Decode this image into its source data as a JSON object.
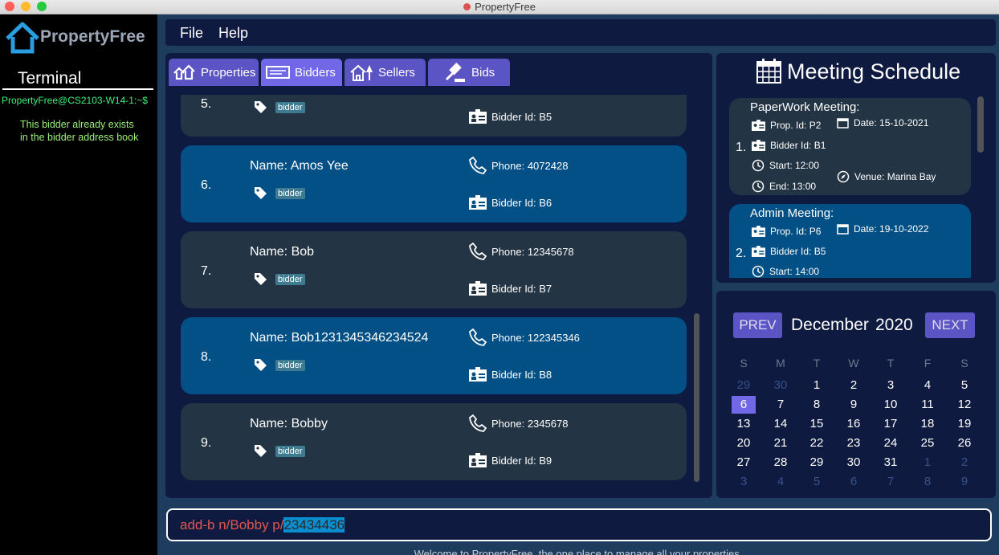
{
  "window": {
    "title": "PropertyFree"
  },
  "app": {
    "logo": "PropertyFree"
  },
  "terminal": {
    "label": "Terminal",
    "prompt": "PropertyFree@CS2103-W14-1:~$",
    "message": "This bidder already exists in the bidder address book"
  },
  "menu": [
    "File",
    "Help"
  ],
  "tabs": [
    {
      "label": "Properties",
      "icon": "houses-icon"
    },
    {
      "label": "Bidders",
      "icon": "id-card-icon"
    },
    {
      "label": "Sellers",
      "icon": "house-tree-icon"
    },
    {
      "label": "Bids",
      "icon": "gavel-icon"
    }
  ],
  "bidders": [
    {
      "index": "5.",
      "name": "",
      "tag": "bidder",
      "phone": "",
      "bidder_id": "Bidder Id: B5"
    },
    {
      "index": "6.",
      "name": "Name: Amos Yee",
      "tag": "bidder",
      "phone": "Phone: 4072428",
      "bidder_id": "Bidder Id: B6"
    },
    {
      "index": "7.",
      "name": "Name: Bob",
      "tag": "bidder",
      "phone": "Phone: 12345678",
      "bidder_id": "Bidder Id: B7"
    },
    {
      "index": "8.",
      "name": "Name: Bob1231345346234524",
      "tag": "bidder",
      "phone": "Phone: 122345346",
      "bidder_id": "Bidder Id: B8"
    },
    {
      "index": "9.",
      "name": "Name: Bobby",
      "tag": "bidder",
      "phone": "Phone: 2345678",
      "bidder_id": "Bidder Id: B9"
    }
  ],
  "schedule": {
    "title": "Meeting Schedule",
    "meetings": [
      {
        "index": "1.",
        "title": "PaperWork Meeting:",
        "prop_id": "Prop. Id: P2",
        "date": "Date: 15-10-2021",
        "bidder_id": "Bidder Id: B1",
        "start": "Start: 12:00",
        "end": "End: 13:00",
        "venue": "Venue: Marina Bay"
      },
      {
        "index": "2.",
        "title": "Admin Meeting:",
        "prop_id": "Prop. Id: P6",
        "date": "Date: 19-10-2022",
        "bidder_id": "Bidder Id: B5",
        "start": "Start: 14:00",
        "end": "",
        "venue": ""
      }
    ]
  },
  "calendar": {
    "prev": "PREV",
    "next": "NEXT",
    "month": "December",
    "year": "2020",
    "weekdays": [
      "S",
      "M",
      "T",
      "W",
      "T",
      "F",
      "S"
    ],
    "days": [
      "29",
      "30",
      "1",
      "2",
      "3",
      "4",
      "5",
      "6",
      "7",
      "8",
      "9",
      "10",
      "11",
      "12",
      "13",
      "14",
      "15",
      "16",
      "17",
      "18",
      "19",
      "20",
      "21",
      "22",
      "23",
      "24",
      "25",
      "26",
      "27",
      "28",
      "29",
      "30",
      "31",
      "1",
      "2",
      "3",
      "4",
      "5",
      "6",
      "7",
      "8",
      "9"
    ],
    "first_in_month": 2,
    "last_in_month": 32,
    "selected": 7,
    "colors": {
      "selected": "#7168e8",
      "other_month": "#37508a"
    }
  },
  "command": {
    "typed": "add-b n/Bobby p/",
    "selected": "23434436"
  },
  "status": "Welcome to PropertyFree, the one place to manage all your properties."
}
